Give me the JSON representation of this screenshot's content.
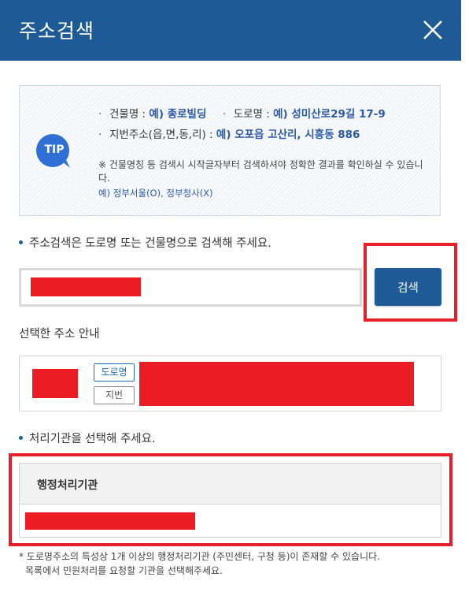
{
  "header": {
    "title": "주소검색",
    "close_icon": "close-icon",
    "background": "#1e5b96"
  },
  "tip": {
    "badge": "TIP",
    "line1_building_label": "건물명 : ",
    "line1_building_example": "예) 종로빌딩",
    "line1_road_label": "도로명 : ",
    "line1_road_example": "예) 성미산로29길 17-9",
    "line2_label": "지번주소(읍,면,동,리) : ",
    "line2_example": "예) 오포읍 고산리, 시흥동 886",
    "note": "※ 건물명칭 등 검색시 시작글자부터 검색하셔야 정확한 결과를 확인하실 수 있습니다.",
    "example": "예) 정부서울(O), 정부청사(X)"
  },
  "search": {
    "instruction": "주소검색은 도로명 또는 건물명으로 검색해 주세요.",
    "button_label": "검색",
    "highlight_color": "#e5202a"
  },
  "selected": {
    "label": "선택한 주소 안내",
    "road_tag": "도로명",
    "jibun_tag": "지번"
  },
  "agency": {
    "instruction": "처리기관을 선택해 주세요.",
    "column_header": "행정처리기관"
  },
  "footnote": {
    "line1": "* 도로명주소의 특성상 1개 이상의 행정처리기관 (주민센터, 구청 등)이 존재할 수 있습니다.",
    "line2": "목록에서 민원처리를 요청할 기관을 선택해주세요."
  },
  "redaction_color": "#ec1c24"
}
